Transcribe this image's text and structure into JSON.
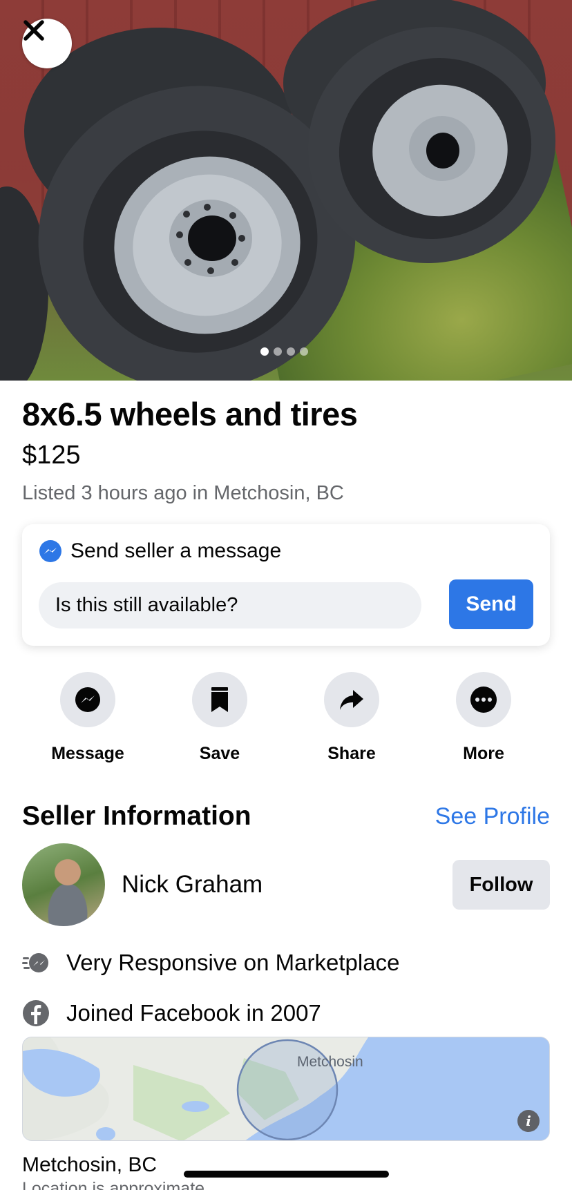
{
  "hero": {
    "image_description_icon": "tires-photo",
    "close_icon": "close-icon",
    "carousel": {
      "total": 4,
      "active_index": 0
    }
  },
  "listing": {
    "title": "8x6.5 wheels and tires",
    "price": "$125",
    "listed": "Listed 3 hours ago in Metchosin, BC"
  },
  "message_card": {
    "heading": "Send seller a message",
    "input_value": "Is this still available?",
    "send_label": "Send",
    "icon": "messenger-icon"
  },
  "actions": [
    {
      "label": "Message",
      "icon": "messenger-icon"
    },
    {
      "label": "Save",
      "icon": "bookmark-icon"
    },
    {
      "label": "Share",
      "icon": "share-arrow-icon"
    },
    {
      "label": "More",
      "icon": "more-dots-icon"
    }
  ],
  "seller": {
    "heading": "Seller Information",
    "see_profile": "See Profile",
    "name": "Nick Graham",
    "follow_label": "Follow",
    "badges": [
      {
        "text": "Very Responsive on Marketplace",
        "icon": "fast-response-icon"
      },
      {
        "text": "Joined Facebook in 2007",
        "icon": "facebook-icon"
      }
    ]
  },
  "map": {
    "label": "Metchosin",
    "info_icon": "info-icon"
  },
  "location": {
    "city": "Metchosin, BC",
    "note": "Location is approximate"
  },
  "colors": {
    "accent": "#2d77e6",
    "secondary_text": "#65676b",
    "button_gray": "#e4e6eb"
  }
}
